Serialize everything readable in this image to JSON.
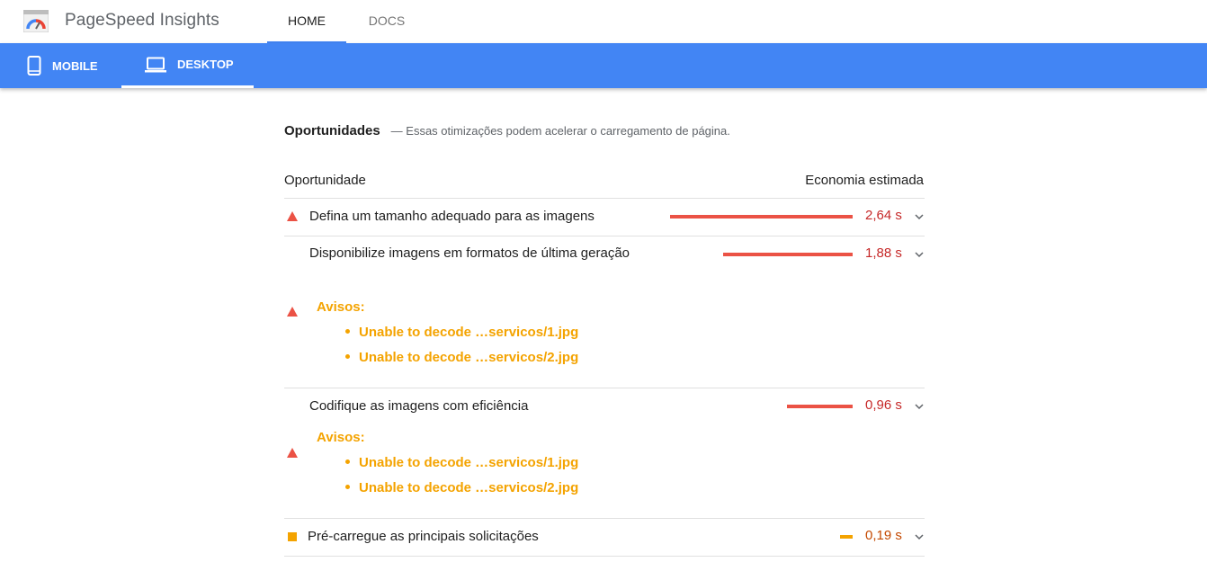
{
  "app": {
    "title": "PageSpeed Insights",
    "nav": [
      {
        "label": "HOME",
        "active": true
      },
      {
        "label": "DOCS",
        "active": false
      }
    ]
  },
  "devices": [
    {
      "label": "MOBILE",
      "icon": "smartphone-icon",
      "active": false
    },
    {
      "label": "DESKTOP",
      "icon": "laptop-icon",
      "active": true
    }
  ],
  "opportunities": {
    "title": "Oportunidades",
    "description": "— Essas otimizações podem acelerar o carregamento de página.",
    "col_left": "Oportunidade",
    "col_right": "Economia estimada",
    "items": [
      {
        "title": "Defina um tamanho adequado para as imagens",
        "value": "2,64 s",
        "savings_fraction": 1.0,
        "severity": "fail",
        "warnings": []
      },
      {
        "title": "Disponibilize imagens em formatos de última geração",
        "value": "1,88 s",
        "savings_fraction": 0.71,
        "severity": "fail",
        "warnings_title": "Avisos:",
        "warnings": [
          "Unable to decode …servicos/1.jpg",
          "Unable to decode …servicos/2.jpg"
        ]
      },
      {
        "title": "Codifique as imagens com eficiência",
        "value": "0,96 s",
        "savings_fraction": 0.36,
        "severity": "fail",
        "warnings_title": "Avisos:",
        "warnings": [
          "Unable to decode …servicos/1.jpg",
          "Unable to decode …servicos/2.jpg"
        ]
      },
      {
        "title": "Pré-carregue as principais solicitações",
        "value": "0,19 s",
        "savings_fraction": 0.07,
        "severity": "average",
        "warnings": []
      }
    ]
  },
  "colors": {
    "brand_blue": "#4285f4",
    "fail_red": "#eb5245",
    "average_orange": "#f4a300"
  }
}
